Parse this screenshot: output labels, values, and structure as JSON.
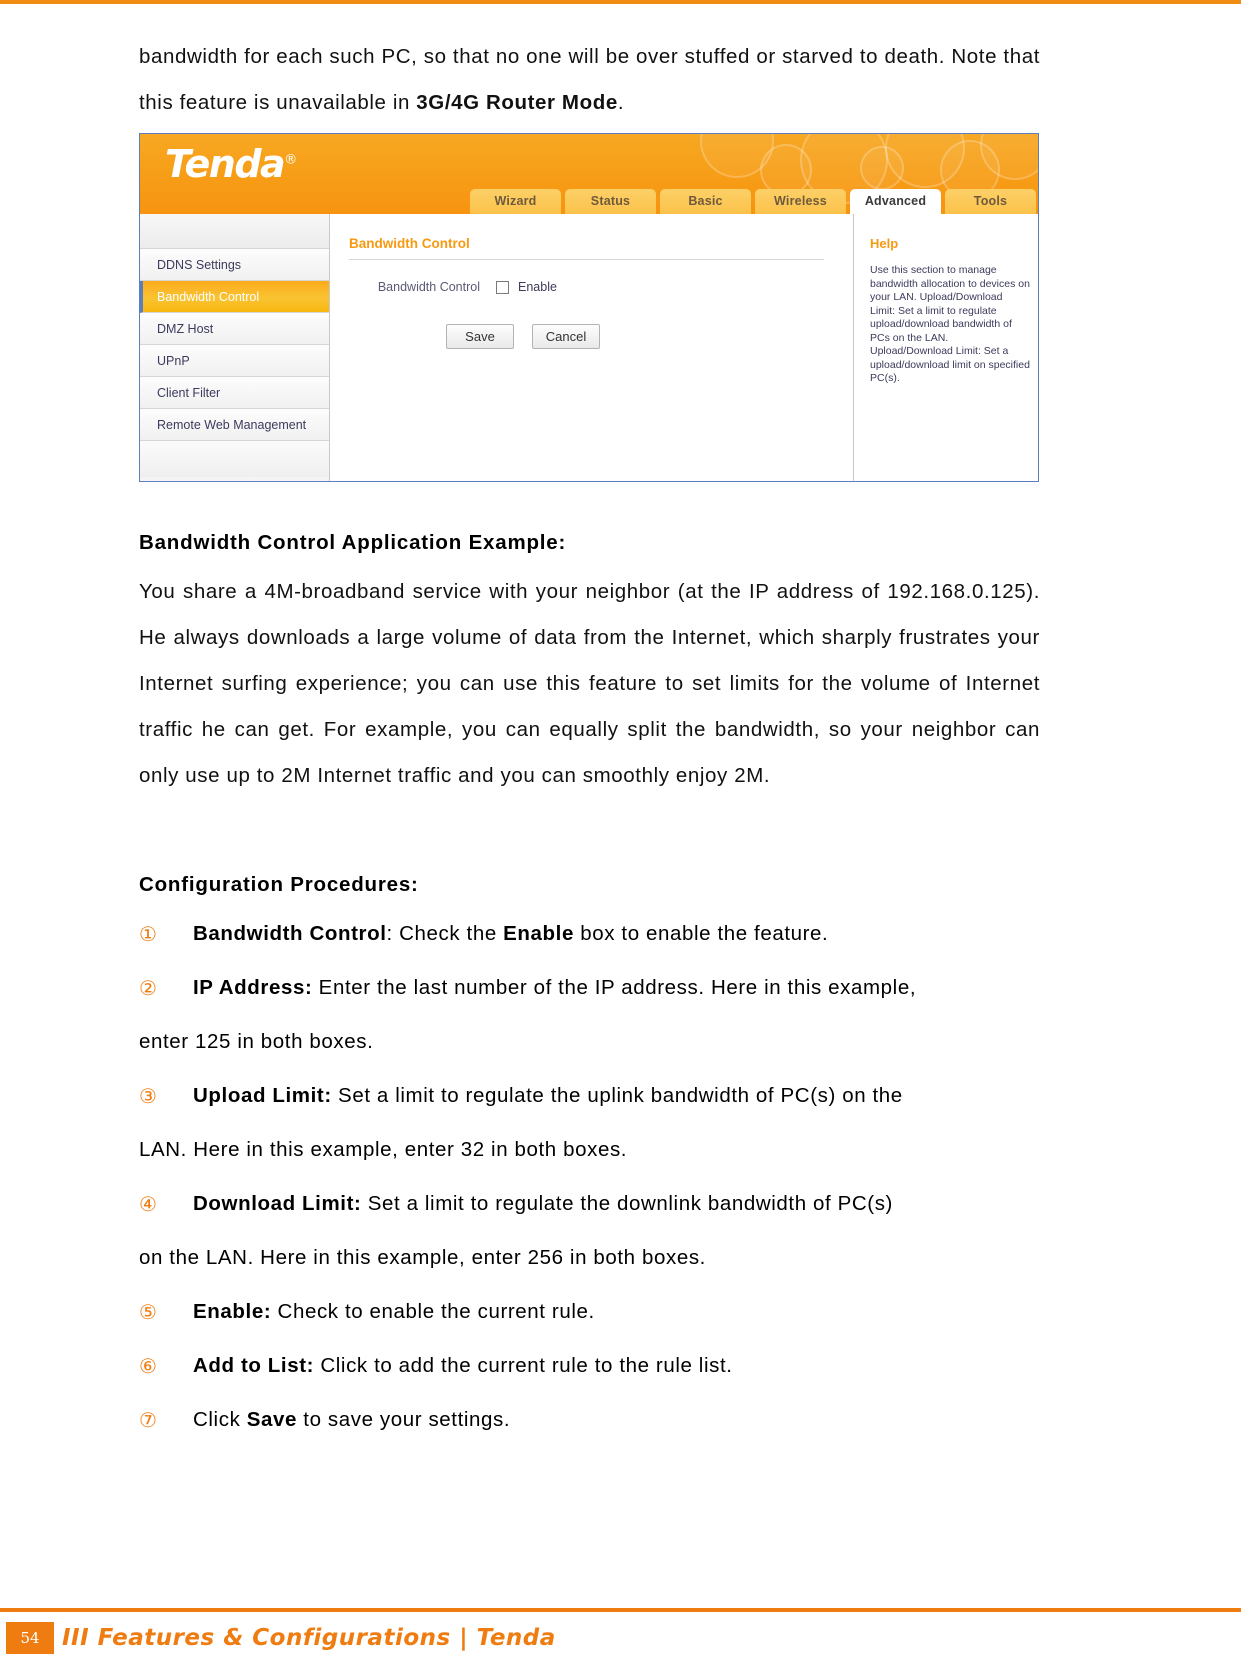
{
  "document": {
    "intro_paragraph_part1": "bandwidth for each such PC, so that no one will be over stuffed or starved to death. Note that this feature is unavailable in ",
    "intro_bold": "3G/4G Router Mode",
    "intro_paragraph_part2": "."
  },
  "router_ui": {
    "brand": "Tenda",
    "brand_reg": "®",
    "tabs": [
      {
        "label": "Wizard",
        "active": false
      },
      {
        "label": "Status",
        "active": false
      },
      {
        "label": "Basic",
        "active": false
      },
      {
        "label": "Wireless",
        "active": false
      },
      {
        "label": "Advanced",
        "active": true
      },
      {
        "label": "Tools",
        "active": false
      }
    ],
    "sidebar": [
      {
        "label": "DDNS Settings",
        "active": false
      },
      {
        "label": "Bandwidth Control",
        "active": true
      },
      {
        "label": "DMZ Host",
        "active": false
      },
      {
        "label": "UPnP",
        "active": false
      },
      {
        "label": "Client Filter",
        "active": false
      },
      {
        "label": "Remote Web Management",
        "active": false
      }
    ],
    "content": {
      "title": "Bandwidth Control",
      "field_label": "Bandwidth Control",
      "checkbox_label": "Enable",
      "checkbox_checked": false,
      "save_label": "Save",
      "cancel_label": "Cancel"
    },
    "help": {
      "title": "Help",
      "body": "Use this section to manage bandwidth allocation to devices on your LAN. Upload/Download Limit: Set a limit to regulate upload/download bandwidth of PCs on the LAN. Upload/Download Limit: Set a upload/download limit on specified PC(s)."
    },
    "colors": {
      "accent_orange": "#f79a13",
      "header_orange": "#f79f18",
      "tab_yellow": "#fbc24a",
      "border_blue": "#5b7fbe"
    }
  },
  "example_section": {
    "heading": "Bandwidth Control Application Example:",
    "paragraph": "You share a 4M-broadband service with your neighbor (at the IP address of 192.168.0.125). He always downloads a large volume of data from the Internet, which sharply frustrates your Internet surfing experience; you can use this feature to set limits for the volume of Internet traffic he can get. For example, you can equally split the bandwidth, so your neighbor can only use up to 2M Internet traffic and you can smoothly enjoy 2M."
  },
  "procedures": {
    "heading": "Configuration Procedures:",
    "items": [
      {
        "marker": "①",
        "bold": "Bandwidth Control",
        "rest": ": Check the ",
        "bold2": "Enable",
        "rest2": " box to enable the feature.",
        "continuation": ""
      },
      {
        "marker": "②",
        "bold": "IP Address:",
        "rest": " Enter the last number of the IP address. Here in this example,",
        "bold2": "",
        "rest2": "",
        "continuation": "enter 125 in both boxes."
      },
      {
        "marker": "③",
        "bold": "Upload Limit:",
        "rest": " Set a limit to regulate the uplink bandwidth of PC(s) on the",
        "bold2": "",
        "rest2": "",
        "continuation": "LAN. Here in this example, enter 32 in both boxes."
      },
      {
        "marker": "④",
        "bold": "Download Limit:",
        "rest": " Set a limit to regulate the downlink bandwidth of PC(s)",
        "bold2": "",
        "rest2": "",
        "continuation": "on the LAN. Here in this example, enter 256 in both boxes."
      },
      {
        "marker": "⑤",
        "bold": "Enable:",
        "rest": " Check to enable the current rule.",
        "bold2": "",
        "rest2": "",
        "continuation": ""
      },
      {
        "marker": "⑥",
        "bold": "Add to List:",
        "rest": " Click to add the current rule to the rule list.",
        "bold2": "",
        "rest2": "",
        "continuation": ""
      },
      {
        "marker": "⑦",
        "bold": "",
        "rest": "Click ",
        "bold2": "Save",
        "rest2": " to save your settings.",
        "continuation": ""
      }
    ]
  },
  "footer": {
    "page_number": "54",
    "text": "III Features & Configurations | Tenda"
  }
}
